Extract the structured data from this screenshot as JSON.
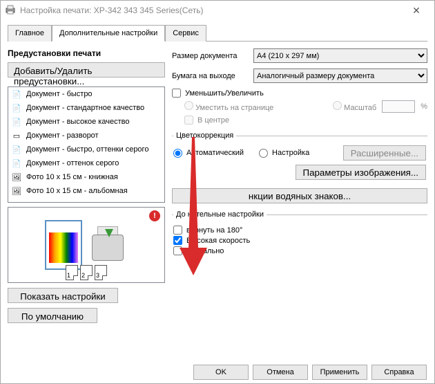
{
  "window": {
    "title": "Настройка печати: XP-342 343 345 Series(Сеть)"
  },
  "tabs": {
    "main": "Главное",
    "advanced": "Дополнительные настройки",
    "service": "Сервис"
  },
  "left": {
    "presets_title": "Предустановки печати",
    "add_remove": "Добавить/Удалить предустановки...",
    "items": [
      "Документ - быстро",
      "Документ - стандартное качество",
      "Документ - высокое качество",
      "Документ - разворот",
      "Документ - быстро, оттенки серого",
      "Документ - оттенок серого",
      "Фото 10 x 15 см - книжная",
      "Фото 10 x 15 см - альбомная"
    ],
    "page_nums": [
      "1",
      "2",
      "3"
    ],
    "show_settings": "Показать настройки",
    "defaults": "По умолчанию"
  },
  "right": {
    "doc_size_label": "Размер документа",
    "doc_size_value": "A4 (210 x 297 мм)",
    "out_paper_label": "Бумага на выходе",
    "out_paper_value": "Аналогичный размеру документа",
    "reduce_enlarge": "Уменьшить/Увеличить",
    "fit_to_page": "Уместить на странице",
    "scale_label": "Масштаб",
    "percent": "%",
    "center": "В центре",
    "color_corr_title": "Цветокоррекция",
    "auto": "Автоматический",
    "custom": "Настройка",
    "advanced_btn": "Расширенные...",
    "image_options": "Параметры изображения...",
    "watermark": "нкции водяных знаков...",
    "extra_title": "До      нительные настройки",
    "rotate180": "  вернуть на 180°",
    "high_speed": "Высокая скорость",
    "mirror": "Зеркально"
  },
  "buttons": {
    "ok": "OK",
    "cancel": "Отмена",
    "apply": "Применить",
    "help": "Справка"
  }
}
